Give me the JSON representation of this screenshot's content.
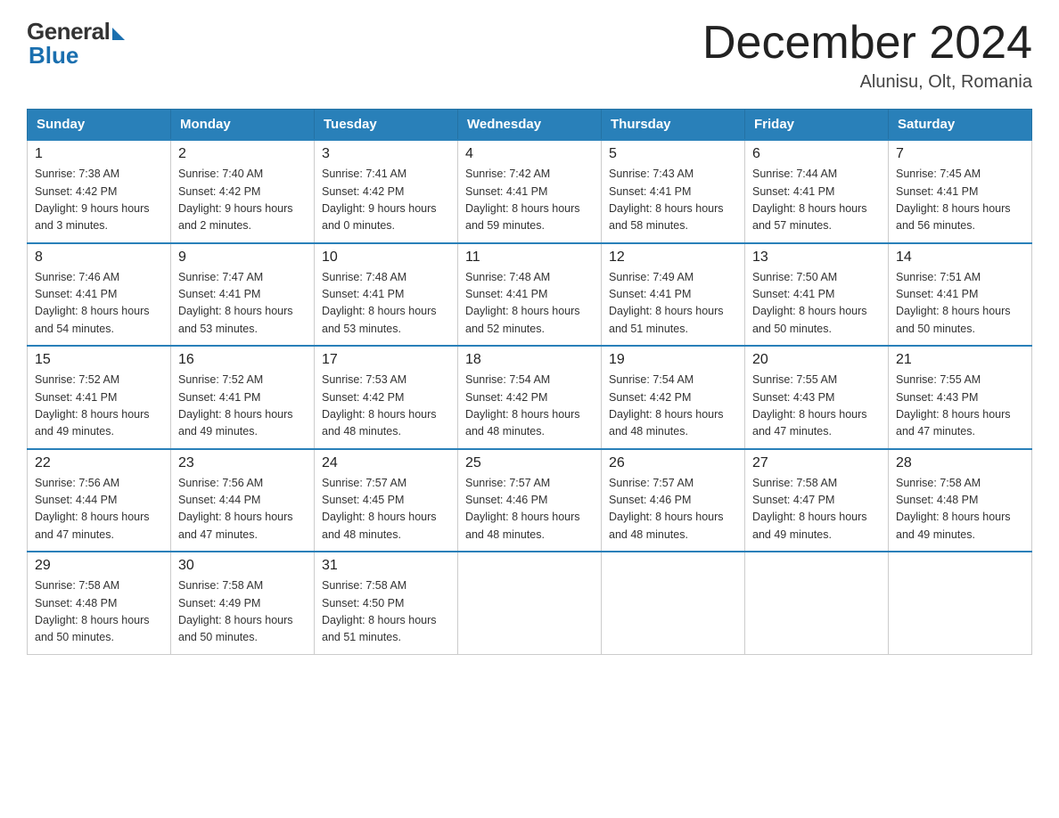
{
  "header": {
    "logo_general": "General",
    "logo_blue": "Blue",
    "title": "December 2024",
    "location": "Alunisu, Olt, Romania"
  },
  "weekdays": [
    "Sunday",
    "Monday",
    "Tuesday",
    "Wednesday",
    "Thursday",
    "Friday",
    "Saturday"
  ],
  "weeks": [
    [
      {
        "day": "1",
        "sunrise": "7:38 AM",
        "sunset": "4:42 PM",
        "daylight": "9 hours and 3 minutes."
      },
      {
        "day": "2",
        "sunrise": "7:40 AM",
        "sunset": "4:42 PM",
        "daylight": "9 hours and 2 minutes."
      },
      {
        "day": "3",
        "sunrise": "7:41 AM",
        "sunset": "4:42 PM",
        "daylight": "9 hours and 0 minutes."
      },
      {
        "day": "4",
        "sunrise": "7:42 AM",
        "sunset": "4:41 PM",
        "daylight": "8 hours and 59 minutes."
      },
      {
        "day": "5",
        "sunrise": "7:43 AM",
        "sunset": "4:41 PM",
        "daylight": "8 hours and 58 minutes."
      },
      {
        "day": "6",
        "sunrise": "7:44 AM",
        "sunset": "4:41 PM",
        "daylight": "8 hours and 57 minutes."
      },
      {
        "day": "7",
        "sunrise": "7:45 AM",
        "sunset": "4:41 PM",
        "daylight": "8 hours and 56 minutes."
      }
    ],
    [
      {
        "day": "8",
        "sunrise": "7:46 AM",
        "sunset": "4:41 PM",
        "daylight": "8 hours and 54 minutes."
      },
      {
        "day": "9",
        "sunrise": "7:47 AM",
        "sunset": "4:41 PM",
        "daylight": "8 hours and 53 minutes."
      },
      {
        "day": "10",
        "sunrise": "7:48 AM",
        "sunset": "4:41 PM",
        "daylight": "8 hours and 53 minutes."
      },
      {
        "day": "11",
        "sunrise": "7:48 AM",
        "sunset": "4:41 PM",
        "daylight": "8 hours and 52 minutes."
      },
      {
        "day": "12",
        "sunrise": "7:49 AM",
        "sunset": "4:41 PM",
        "daylight": "8 hours and 51 minutes."
      },
      {
        "day": "13",
        "sunrise": "7:50 AM",
        "sunset": "4:41 PM",
        "daylight": "8 hours and 50 minutes."
      },
      {
        "day": "14",
        "sunrise": "7:51 AM",
        "sunset": "4:41 PM",
        "daylight": "8 hours and 50 minutes."
      }
    ],
    [
      {
        "day": "15",
        "sunrise": "7:52 AM",
        "sunset": "4:41 PM",
        "daylight": "8 hours and 49 minutes."
      },
      {
        "day": "16",
        "sunrise": "7:52 AM",
        "sunset": "4:41 PM",
        "daylight": "8 hours and 49 minutes."
      },
      {
        "day": "17",
        "sunrise": "7:53 AM",
        "sunset": "4:42 PM",
        "daylight": "8 hours and 48 minutes."
      },
      {
        "day": "18",
        "sunrise": "7:54 AM",
        "sunset": "4:42 PM",
        "daylight": "8 hours and 48 minutes."
      },
      {
        "day": "19",
        "sunrise": "7:54 AM",
        "sunset": "4:42 PM",
        "daylight": "8 hours and 48 minutes."
      },
      {
        "day": "20",
        "sunrise": "7:55 AM",
        "sunset": "4:43 PM",
        "daylight": "8 hours and 47 minutes."
      },
      {
        "day": "21",
        "sunrise": "7:55 AM",
        "sunset": "4:43 PM",
        "daylight": "8 hours and 47 minutes."
      }
    ],
    [
      {
        "day": "22",
        "sunrise": "7:56 AM",
        "sunset": "4:44 PM",
        "daylight": "8 hours and 47 minutes."
      },
      {
        "day": "23",
        "sunrise": "7:56 AM",
        "sunset": "4:44 PM",
        "daylight": "8 hours and 47 minutes."
      },
      {
        "day": "24",
        "sunrise": "7:57 AM",
        "sunset": "4:45 PM",
        "daylight": "8 hours and 48 minutes."
      },
      {
        "day": "25",
        "sunrise": "7:57 AM",
        "sunset": "4:46 PM",
        "daylight": "8 hours and 48 minutes."
      },
      {
        "day": "26",
        "sunrise": "7:57 AM",
        "sunset": "4:46 PM",
        "daylight": "8 hours and 48 minutes."
      },
      {
        "day": "27",
        "sunrise": "7:58 AM",
        "sunset": "4:47 PM",
        "daylight": "8 hours and 49 minutes."
      },
      {
        "day": "28",
        "sunrise": "7:58 AM",
        "sunset": "4:48 PM",
        "daylight": "8 hours and 49 minutes."
      }
    ],
    [
      {
        "day": "29",
        "sunrise": "7:58 AM",
        "sunset": "4:48 PM",
        "daylight": "8 hours and 50 minutes."
      },
      {
        "day": "30",
        "sunrise": "7:58 AM",
        "sunset": "4:49 PM",
        "daylight": "8 hours and 50 minutes."
      },
      {
        "day": "31",
        "sunrise": "7:58 AM",
        "sunset": "4:50 PM",
        "daylight": "8 hours and 51 minutes."
      },
      null,
      null,
      null,
      null
    ]
  ],
  "labels": {
    "sunrise": "Sunrise:",
    "sunset": "Sunset:",
    "daylight": "Daylight:"
  }
}
